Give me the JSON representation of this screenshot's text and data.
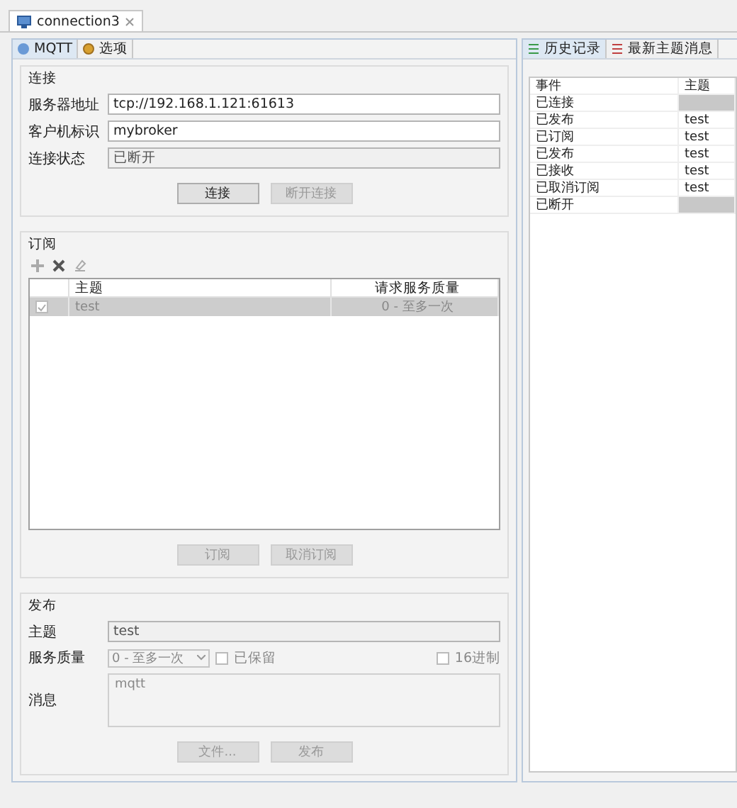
{
  "editor_tab": {
    "title": "connection3",
    "selected": true
  },
  "left_tabs": [
    {
      "label": "MQTT",
      "selected": true
    },
    {
      "label": "选项",
      "selected": false
    }
  ],
  "connection": {
    "title": "连接",
    "fields": [
      {
        "label": "服务器地址",
        "value": "tcp://192.168.1.121:61613",
        "disabled": false
      },
      {
        "label": "客户机标识",
        "value": "mybroker",
        "disabled": false
      },
      {
        "label": "连接状态",
        "value": "已断开",
        "disabled": true
      }
    ],
    "buttons": [
      {
        "label": "连接",
        "disabled": false
      },
      {
        "label": "断开连接",
        "disabled": true
      }
    ]
  },
  "subscribe": {
    "title": "订阅",
    "columns": [
      "主题",
      "请求服务质量"
    ],
    "rows": [
      {
        "checked": true,
        "topic": "test",
        "qos": "0 - 至多一次",
        "selected": true
      }
    ],
    "buttons": [
      {
        "label": "订阅",
        "disabled": true
      },
      {
        "label": "取消订阅",
        "disabled": true
      }
    ]
  },
  "publish": {
    "title": "发布",
    "topic_label": "主题",
    "topic_value": "test",
    "qos_label": "服务质量",
    "qos_value": "0 - 至多一次",
    "retained": {
      "label": "已保留",
      "checked": false
    },
    "hex": {
      "label": "16进制",
      "checked": false
    },
    "message_label": "消息",
    "message_value": "mqtt",
    "buttons": [
      {
        "label": "文件...",
        "disabled": true
      },
      {
        "label": "发布",
        "disabled": true
      }
    ]
  },
  "right_tabs": [
    {
      "label": "历史记录",
      "selected": true
    },
    {
      "label": "最新主题消息",
      "selected": false
    }
  ],
  "history": {
    "columns": [
      "事件",
      "主题"
    ],
    "rows": [
      {
        "event": "已连接"
      },
      {
        "event": "已发布",
        "topic": "test"
      },
      {
        "event": "已订阅",
        "topic": "test"
      },
      {
        "event": "已发布",
        "topic": "test"
      },
      {
        "event": "已接收",
        "topic": "test"
      },
      {
        "event": "已取消订阅",
        "topic": "test"
      },
      {
        "event": "已断开"
      }
    ]
  }
}
